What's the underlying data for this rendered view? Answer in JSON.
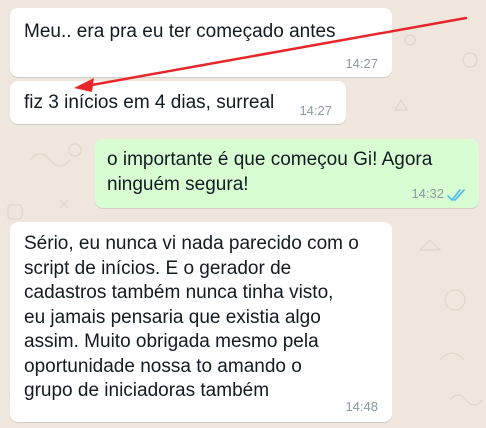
{
  "colors": {
    "incoming_bubble": "#ffffff",
    "outgoing_bubble": "#d9fdd3",
    "background": "#efe7dd",
    "read_ticks": "#53bdeb",
    "annotation_arrow": "#e8262a"
  },
  "messages": [
    {
      "direction": "incoming",
      "text": "Meu.. era pra eu ter começado antes",
      "time": "14:27"
    },
    {
      "direction": "incoming",
      "text": "fiz 3 inícios em 4 dias, surreal",
      "time": "14:27"
    },
    {
      "direction": "outgoing",
      "text": "o importante é que começou Gi! Agora\nninguém segura!",
      "time": "14:32",
      "status_icon": "double-check-read-icon"
    },
    {
      "direction": "incoming",
      "text": "Sério, eu nunca vi nada parecido com o\nscript de inícios. E o gerador de\ncadastros também nunca tinha visto,\neu jamais pensaria que existia algo\nassim. Muito obrigada mesmo pela\noportunidade nossa to amando o\ngrupo de iniciadoras também",
      "time": "14:48"
    }
  ],
  "annotation": {
    "icon": "red-arrow-annotation-icon"
  }
}
